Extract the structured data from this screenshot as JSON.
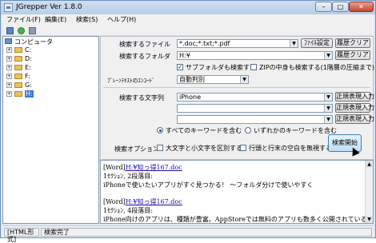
{
  "window": {
    "title": "JGrepper Ver 1.8.0",
    "min": "–",
    "max": "□",
    "close": "✕"
  },
  "menu": [
    "ファイル(F)",
    "編集(E)",
    "検索(S)",
    "ヘルプ(H)"
  ],
  "toolbar": {
    "icons": [
      "open-icon",
      "refresh-icon",
      "settings-icon"
    ]
  },
  "tree": {
    "root": "コンピュータ",
    "drives": [
      "C:",
      "D:",
      "E:",
      "F:",
      "G:",
      "H:"
    ],
    "selected": "H:"
  },
  "form": {
    "file_label": "検索するファイル",
    "file_value": "*.doc;*.txt;*.pdf",
    "file_settings_btn": "ﾌｧｲﾙ設定",
    "file_clear_btn": "履歴クリア",
    "folder_label": "検索するフォルダ",
    "folder_value": "H:¥",
    "folder_clear_btn": "履歴クリア",
    "subfolder_check": "サブフォルダも検索する",
    "zip_check": "ZIPの中身も検索する(1階層の圧縮まで)",
    "encoding_label": "ﾌﾟﾚｰﾝﾃｷｽﾄのｴﾝｺｰﾄﾞ",
    "encoding_value": "自動判別",
    "string_label": "検索する文字列",
    "string_values": [
      "iPhone",
      "",
      ""
    ],
    "regex_btn": "正規表現入力",
    "all_keywords": "すべてのキーワードを含む",
    "any_keywords": "いずれかのキーワードを含む",
    "options_label": "検索オプション",
    "case_check": "大文字と小文字を区別する",
    "whitespace_check": "行頭と行末の空白を無視する",
    "search_btn": "検索開始"
  },
  "results": [
    {
      "tag": "[Word]",
      "path": "H:¥知っ得167.doc"
    },
    {
      "text": "1ｾｸｼｮﾝ, 2段落目:"
    },
    {
      "text": "iPhoneで使いたいアプリがすぐ見つかる！ 〜フォルダ分けで使いやすく"
    },
    {
      "text": ""
    },
    {
      "tag": "[Word]",
      "path": "H:¥知っ得167.doc"
    },
    {
      "text": "1ｾｸｼｮﾝ, 4段落目:"
    },
    {
      "text": "iPhone向けのアプリは、種類が豊富。AppStoreでは無料のアプリも数多く公開されている。"
    }
  ],
  "status": {
    "mode": "[HTML形式]",
    "message": "検索完了"
  }
}
